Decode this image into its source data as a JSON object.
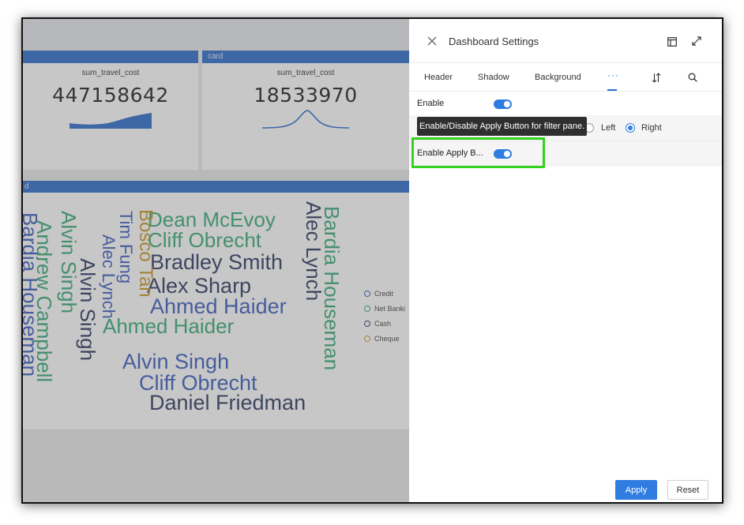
{
  "dashboard": {
    "cards": [
      {
        "header": "",
        "field": "sum_travel_cost",
        "value": "447158642"
      },
      {
        "header": "card",
        "field": "sum_travel_cost",
        "value": "18533970"
      }
    ],
    "cloud_panel": {
      "header": "d",
      "words": [
        "Dean McEvoy",
        "Cliff Obrecht",
        "Bradley Smith",
        "Alex Sharp",
        "Ahmed Haider",
        "Ahmed Haider",
        "Alvin Singh",
        "Cliff Obrecht",
        "Daniel Friedman",
        "Alvin Singh",
        "Andrew Campbell",
        "Bardia Houseman",
        "Alvin Singh",
        "Tim Fung",
        "Alec Lynch",
        "Bosco Tan",
        "Alec Lynch",
        "Bardia Houseman"
      ],
      "legend": [
        {
          "label": "Credit",
          "color": "#3c5fbf"
        },
        {
          "label": "Net Banki",
          "color": "#3aaa7a"
        },
        {
          "label": "Cash",
          "color": "#2f3c63"
        },
        {
          "label": "Cheque",
          "color": "#c89a2a"
        }
      ]
    }
  },
  "drawer": {
    "title": "Dashboard Settings",
    "tabs": [
      "Header",
      "Shadow",
      "Background"
    ],
    "more_tab": "···",
    "settings": {
      "enable_label": "Enable",
      "enable_on": true,
      "position_options": [
        "Left",
        "Right"
      ],
      "position_selected": "Right",
      "apply_label": "Enable Apply B...",
      "apply_on": true
    },
    "tooltip": "Enable/Disable Apply Button for filter pane.",
    "buttons": {
      "apply": "Apply",
      "reset": "Reset"
    }
  },
  "colors": {
    "accent": "#2f7de1",
    "card_header": "#2f6fcb",
    "highlight": "#34d11f",
    "tooltip_bg": "#2f2f2f"
  },
  "icons": [
    "close-icon",
    "layout-icon",
    "expand-icon",
    "sort-icon",
    "search-icon"
  ]
}
